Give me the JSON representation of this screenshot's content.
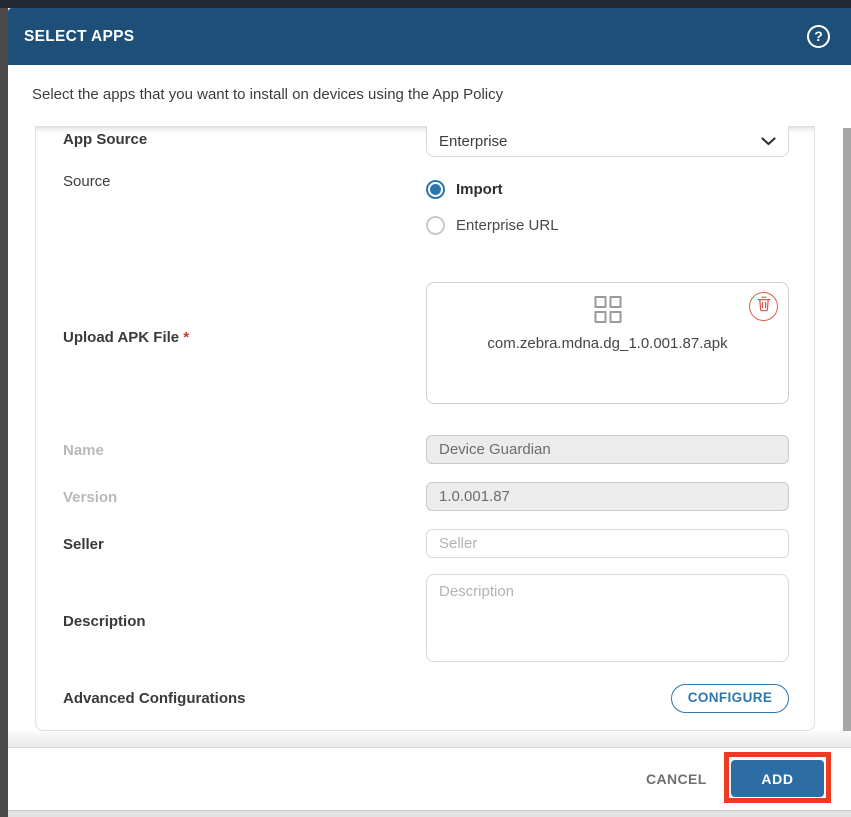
{
  "header": {
    "title": "SELECT APPS",
    "help_glyph": "?"
  },
  "subtitle": "Select the apps that you want to install on devices using the App Policy",
  "form": {
    "app_source": {
      "label": "App Source",
      "value": "Enterprise"
    },
    "source": {
      "label": "Source",
      "options": [
        {
          "label": "Import",
          "selected": true
        },
        {
          "label": "Enterprise URL",
          "selected": false
        }
      ]
    },
    "upload": {
      "label": "Upload APK File",
      "required_marker": "*",
      "filename": "com.zebra.mdna.dg_1.0.001.87.apk"
    },
    "name": {
      "label": "Name",
      "value": "Device Guardian"
    },
    "version": {
      "label": "Version",
      "value": "1.0.001.87"
    },
    "seller": {
      "label": "Seller",
      "placeholder": "Seller"
    },
    "description": {
      "label": "Description",
      "placeholder": "Description"
    },
    "advanced": {
      "label": "Advanced Configurations",
      "button_label": "CONFIGURE"
    }
  },
  "footer": {
    "cancel_label": "CANCEL",
    "add_label": "ADD"
  },
  "colors": {
    "header_bg": "#1e4f78",
    "accent_blue": "#2e77ac",
    "add_button_bg": "#2e6da4",
    "annotation_red": "#ee3a21",
    "delete_red": "#d9534f",
    "scrollbar_grey": "#a6a6a6"
  }
}
